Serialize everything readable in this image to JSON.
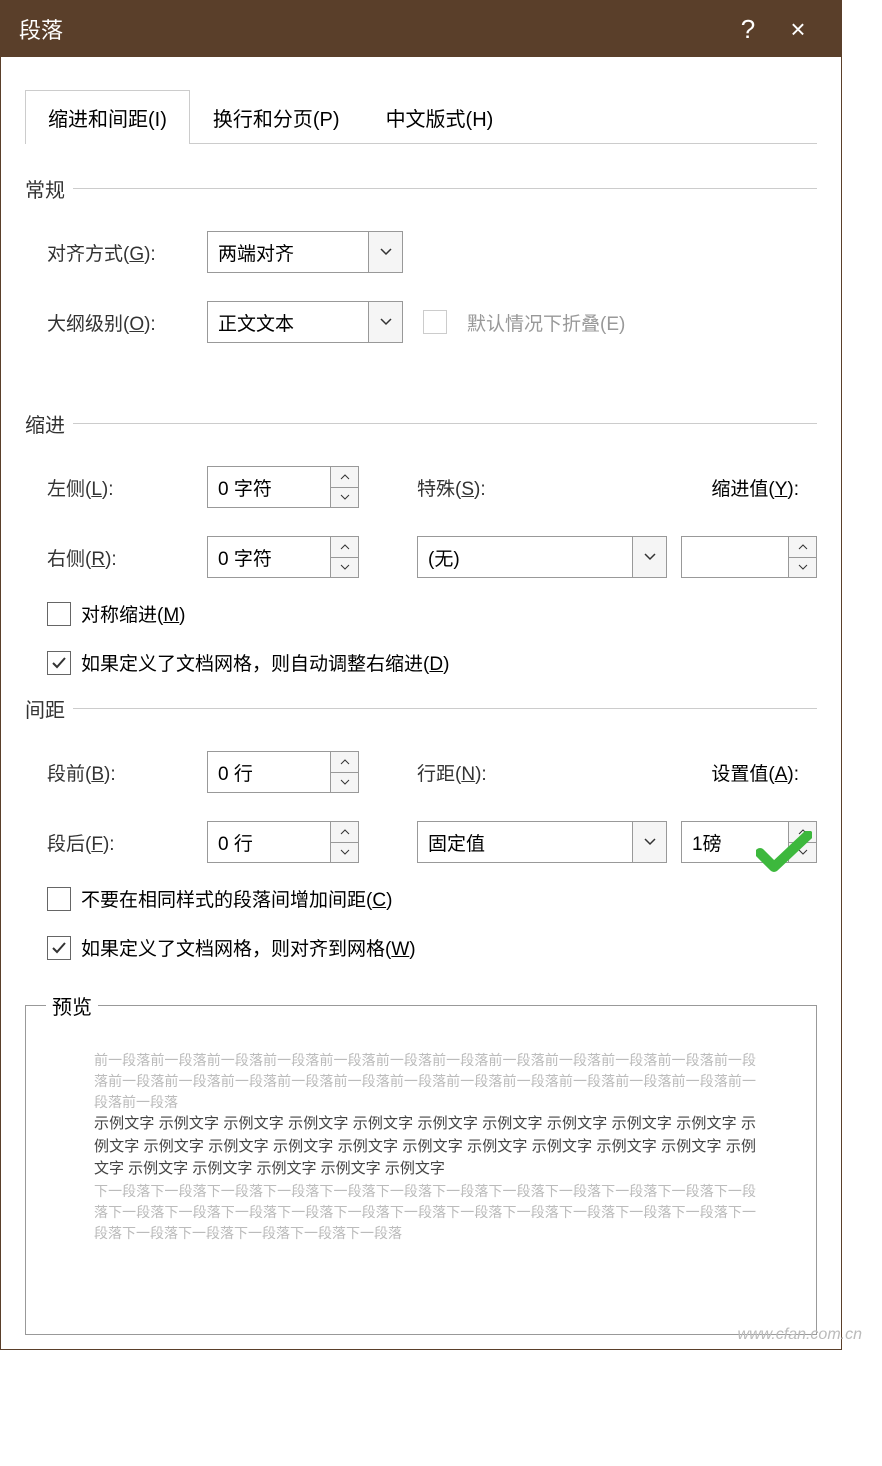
{
  "title": "段落",
  "help": "?",
  "close": "×",
  "tabs": [
    "缩进和间距(I)",
    "换行和分页(P)",
    "中文版式(H)"
  ],
  "general": {
    "label": "常规",
    "align_label": "对齐方式(G):",
    "align_value": "两端对齐",
    "outline_label": "大纲级别(O):",
    "outline_value": "正文文本",
    "collapse_label": "默认情况下折叠(E)"
  },
  "indent": {
    "label": "缩进",
    "left_label": "左侧(L):",
    "left_value": "0 字符",
    "right_label": "右侧(R):",
    "right_value": "0 字符",
    "special_label": "特殊(S):",
    "special_value": "(无)",
    "by_label": "缩进值(Y):",
    "by_value": "",
    "mirror_label": "对称缩进(M)",
    "grid_label": "如果定义了文档网格，则自动调整右缩进(D)"
  },
  "spacing": {
    "label": "间距",
    "before_label": "段前(B):",
    "before_value": "0 行",
    "after_label": "段后(F):",
    "after_value": "0 行",
    "line_label": "行距(N):",
    "line_value": "固定值",
    "at_label": "设置值(A):",
    "at_value": "1磅",
    "no_space_label": "不要在相同样式的段落间增加间距(C)",
    "snap_label": "如果定义了文档网格，则对齐到网格(W)"
  },
  "preview": {
    "label": "预览",
    "prev_para": "前一段落前一段落前一段落前一段落前一段落前一段落前一段落前一段落前一段落前一段落前一段落前一段落前一段落前一段落前一段落前一段落前一段落前一段落前一段落前一段落前一段落前一段落前一段落前一段落前一段落",
    "sample": "示例文字 示例文字 示例文字 示例文字 示例文字 示例文字 示例文字 示例文字 示例文字 示例文字 示例文字 示例文字 示例文字 示例文字 示例文字 示例文字 示例文字 示例文字 示例文字 示例文字 示例文字 示例文字 示例文字 示例文字 示例文字 示例文字",
    "next_para": "下一段落下一段落下一段落下一段落下一段落下一段落下一段落下一段落下一段落下一段落下一段落下一段落下一段落下一段落下一段落下一段落下一段落下一段落下一段落下一段落下一段落下一段落下一段落下一段落下一段落下一段落下一段落下一段落下一段落"
  },
  "watermark": "www.cfan.com.cn"
}
